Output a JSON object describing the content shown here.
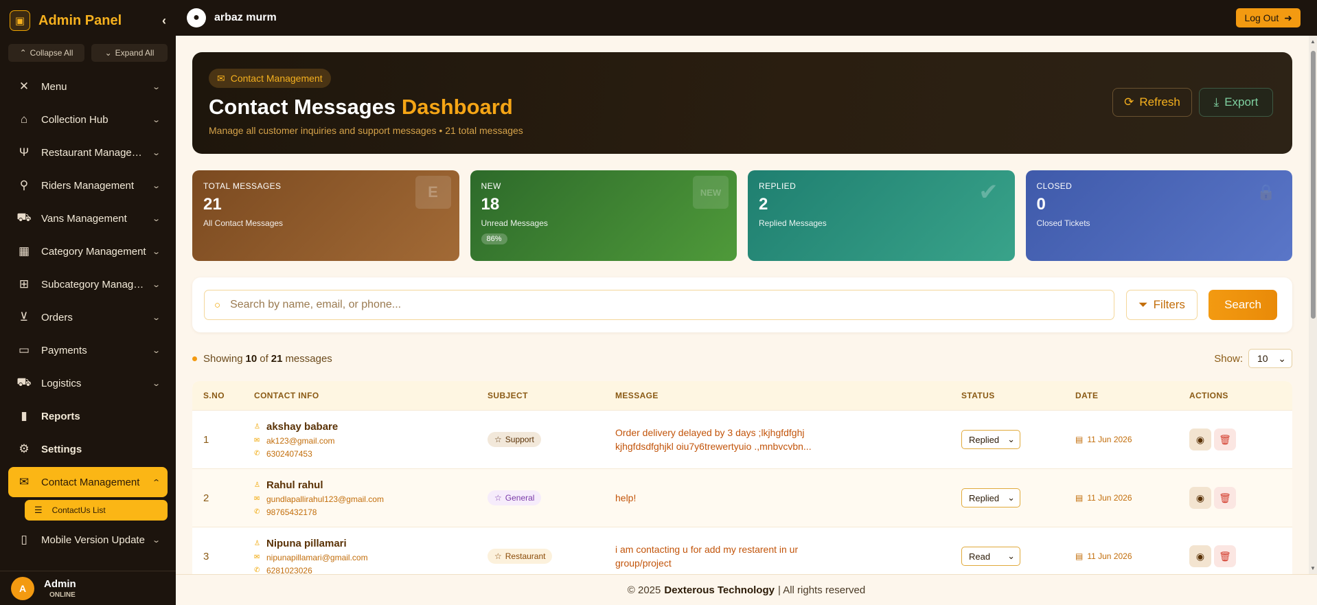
{
  "sidebar": {
    "title": "Admin Panel",
    "collapse_all": "Collapse All",
    "expand_all": "Expand All",
    "items": [
      {
        "label": "Menu"
      },
      {
        "label": "Collection Hub"
      },
      {
        "label": "Restaurant Management"
      },
      {
        "label": "Riders Management"
      },
      {
        "label": "Vans Management"
      },
      {
        "label": "Category Management"
      },
      {
        "label": "Subcategory Management"
      },
      {
        "label": "Orders"
      },
      {
        "label": "Payments"
      },
      {
        "label": "Logistics"
      },
      {
        "label": "Reports"
      },
      {
        "label": "Settings"
      },
      {
        "label": "Contact Management"
      },
      {
        "label": "Mobile Version Update"
      }
    ],
    "subitem": "ContactUs List",
    "footer": {
      "avatar": "A",
      "name": "Admin",
      "status": "ONLINE"
    }
  },
  "topbar": {
    "user": "arbaz murm",
    "logout": "Log Out"
  },
  "hero": {
    "badge": "Contact Management",
    "title_main": "Contact Messages",
    "title_accent": "Dashboard",
    "subtitle": "Manage all customer inquiries and support messages • 21 total messages",
    "refresh": "Refresh",
    "export": "Export"
  },
  "stats": [
    {
      "label": "TOTAL MESSAGES",
      "value": "21",
      "desc": "All Contact Messages",
      "deco": "E"
    },
    {
      "label": "NEW",
      "value": "18",
      "desc": "Unread Messages",
      "pill": "86%",
      "deco": "NEW"
    },
    {
      "label": "REPLIED",
      "value": "2",
      "desc": "Replied Messages",
      "deco": "✔"
    },
    {
      "label": "CLOSED",
      "value": "0",
      "desc": "Closed Tickets",
      "deco": "🔒"
    }
  ],
  "search": {
    "placeholder": "Search by name, email, or phone...",
    "filters": "Filters",
    "button": "Search"
  },
  "listing": {
    "prefix": "Showing",
    "shown": "10",
    "of": "of",
    "total": "21",
    "suffix": "messages",
    "show_label": "Show:",
    "page_size": "10"
  },
  "table": {
    "headers": [
      "S.NO",
      "CONTACT INFO",
      "SUBJECT",
      "MESSAGE",
      "STATUS",
      "DATE",
      "ACTIONS"
    ],
    "rows": [
      {
        "sno": "1",
        "name": "akshay babare",
        "email": "ak123@gmail.com",
        "phone": "6302407453",
        "subject": "Support",
        "message": "Order delivery delayed by 3 days ;lkjhgfdfghj kjhgfdsdfghjkl oiu7y6trewertyuio .,mnbvcvbn...",
        "status": "Replied",
        "date": "11 Jun 2026"
      },
      {
        "sno": "2",
        "name": "Rahul rahul",
        "email": "gundlapallirahul123@gmail.com",
        "phone": "98765432178",
        "subject": "General",
        "message": "help!",
        "status": "Replied",
        "date": "11 Jun 2026"
      },
      {
        "sno": "3",
        "name": "Nipuna pillamari",
        "email": "nipunapillamari@gmail.com",
        "phone": "6281023026",
        "subject": "Restaurant",
        "message": "i am contacting u for add my restarent in ur group/project",
        "status": "Read",
        "date": "11 Jun 2026"
      }
    ]
  },
  "footer": {
    "prefix": "© 2025",
    "company": "Dexterous Technology",
    "suffix": "| All rights reserved"
  }
}
